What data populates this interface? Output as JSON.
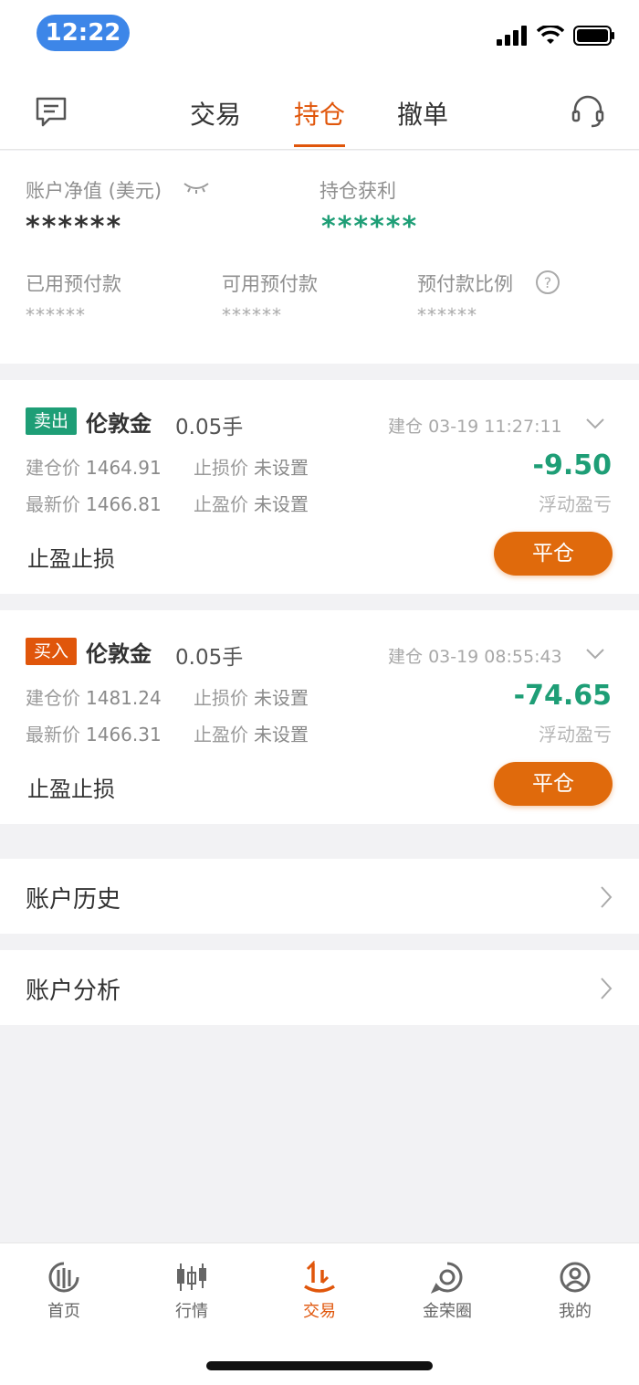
{
  "status": {
    "time": "12:22"
  },
  "header": {
    "tabs": [
      "交易",
      "持仓",
      "撤单"
    ],
    "active_tab": 1
  },
  "summary": {
    "net_value_label": "账户净值 (美元)",
    "net_value": "******",
    "profit_label": "持仓获利",
    "profit": "******",
    "used_label": "已用预付款",
    "used": "******",
    "available_label": "可用预付款",
    "available": "******",
    "ratio_label": "预付款比例",
    "ratio": "******"
  },
  "positions": [
    {
      "side": "卖出",
      "side_color": "#1e9e76",
      "symbol": "伦敦金",
      "lots": "0.05手",
      "open_label": "建仓",
      "open_time": "03-19 11:27:11",
      "open_price_label": "建仓价",
      "open_price": "1464.91",
      "latest_price_label": "最新价",
      "latest_price": "1466.81",
      "stop_loss_label": "止损价",
      "stop_loss": "未设置",
      "take_profit_label": "止盈价",
      "take_profit": "未设置",
      "pnl": "-9.50",
      "pnl_label": "浮动盈亏",
      "sltp_label": "止盈止损",
      "close_label": "平仓"
    },
    {
      "side": "买入",
      "side_color": "#e0560b",
      "symbol": "伦敦金",
      "lots": "0.05手",
      "open_label": "建仓",
      "open_time": "03-19 08:55:43",
      "open_price_label": "建仓价",
      "open_price": "1481.24",
      "latest_price_label": "最新价",
      "latest_price": "1466.31",
      "stop_loss_label": "止损价",
      "stop_loss": "未设置",
      "take_profit_label": "止盈价",
      "take_profit": "未设置",
      "pnl": "-74.65",
      "pnl_label": "浮动盈亏",
      "sltp_label": "止盈止损",
      "close_label": "平仓"
    }
  ],
  "links": {
    "history": "账户历史",
    "analysis": "账户分析"
  },
  "tabbar": {
    "items": [
      "首页",
      "行情",
      "交易",
      "金荣圈",
      "我的"
    ],
    "active": 2
  },
  "colors": {
    "accent": "#e0560b",
    "profit_green": "#1e9e76",
    "status_blue": "#3d86e8"
  }
}
